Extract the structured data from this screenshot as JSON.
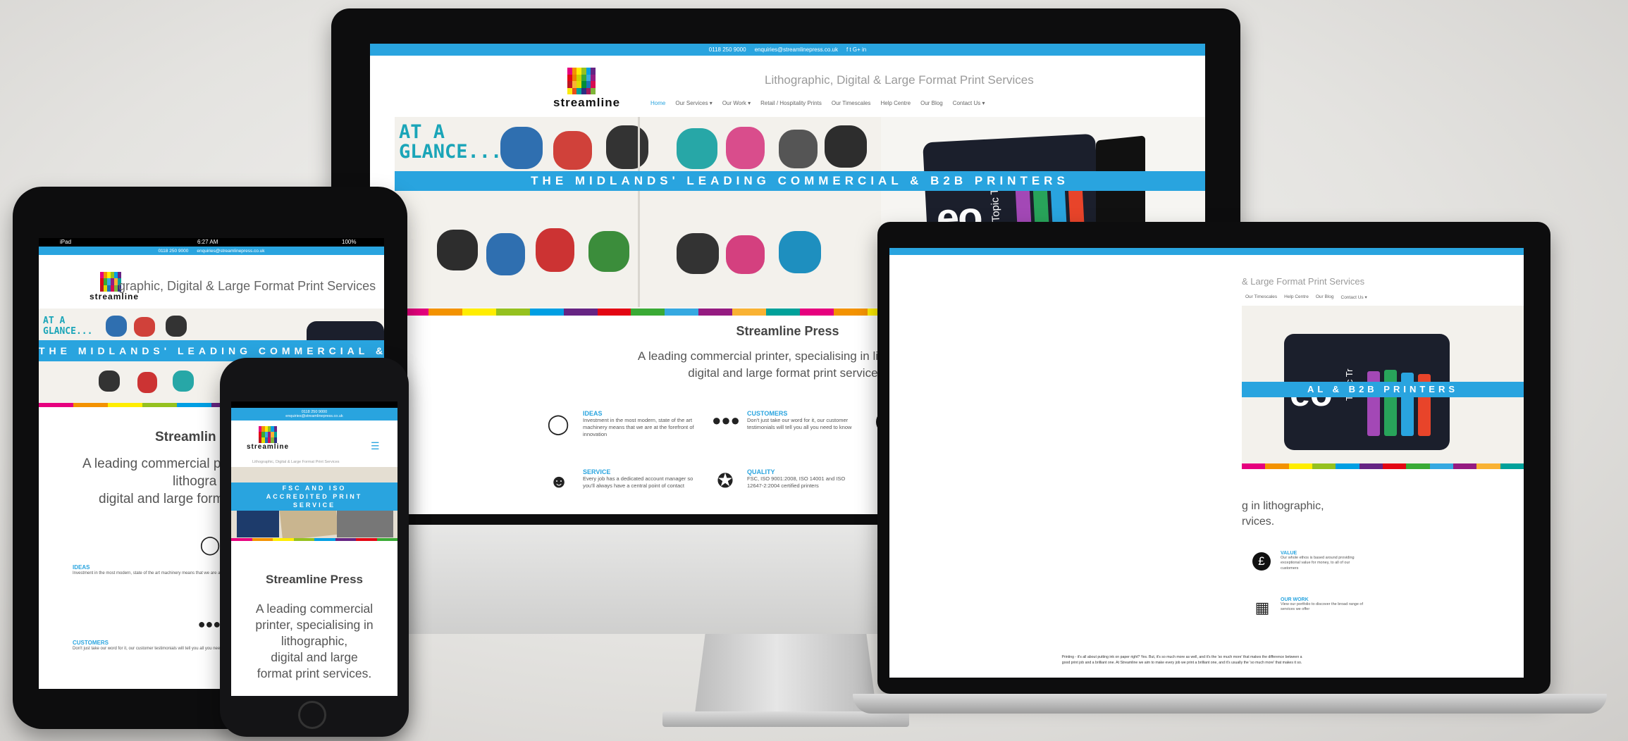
{
  "contact": {
    "phone": "0118 250 9000",
    "email": "enquiries@streamlinepress.co.uk",
    "social": "f  t  G+  in"
  },
  "brand": {
    "logo_text": "streamline",
    "tagline": "Lithographic, Digital & Large Format Print Services",
    "tagline_cut_tablet": "graphic, Digital & Large Format Print Services",
    "tagline_cut_laptop": "& Large Format Print Services"
  },
  "nav": [
    {
      "label": "Home"
    },
    {
      "label": "Our Services ▾"
    },
    {
      "label": "Our Work ▾"
    },
    {
      "label": "Retail / Hospitality Prints"
    },
    {
      "label": "Our Timescales"
    },
    {
      "label": "Help Centre"
    },
    {
      "label": "Our Blog"
    },
    {
      "label": "Contact Us ▾"
    }
  ],
  "hero": {
    "band": "THE MIDLANDS' LEADING COMMERCIAL & B2B PRINTERS",
    "band_tablet": "THE MIDLANDS' LEADING COMMERCIAL & B2B PRIN",
    "band_laptop": "AL & B2B PRINTERS",
    "band_phone": "FSC AND ISO ACCREDITED PRINT SERVICE",
    "mag_text": "AT A GLANCE...",
    "book_text": "Topic T",
    "book_text_laptop": "Topic Tr"
  },
  "content": {
    "title": "Streamline Press",
    "title_tablet": "Streamlin",
    "lead_1": "A leading commercial printer, specialising in lithographic,",
    "lead_2": "digital and large format print services.",
    "lead_tablet_1": "A leading commercial pr",
    "lead_tablet_2": "lithogra",
    "lead_tablet_3": "digital and large form",
    "lead_laptop_1": "g in lithographic,",
    "lead_laptop_2": "rvices.",
    "phone_lead": [
      "A leading commercial",
      "printer, specialising in",
      "lithographic,",
      "digital and large",
      "format print services."
    ],
    "footer_1": "Printing - it's all about putting ink on paper right? Yes. But, it's so much more as well, and it's the 'so much more' that makes the difference between a",
    "footer_2": "good print job and a brilliant one. At Streamline we aim to make every job we print a brilliant one, and it's usually the 'so much more' that makes it so."
  },
  "features": [
    {
      "icon": "lightbulb-icon",
      "title": "IDEAS",
      "text": "Investment in the most modern, state of the art machinery means that we are at the forefront of innovation"
    },
    {
      "icon": "people-icon",
      "title": "CUSTOMERS",
      "text": "Don't just take our word for it, our customer testimonials will tell you all you need to know"
    },
    {
      "icon": "pound-icon",
      "title": "VALUE",
      "text": "Our whole ethos is based around providing exceptional value for money, to all of our customers"
    },
    {
      "icon": "smiley-icon",
      "title": "SERVICE",
      "text": "Every job has a dedicated account manager so you'll always have a central point of contact"
    },
    {
      "icon": "award-icon",
      "title": "QUALITY",
      "text": "FSC, ISO 9001:2008, ISO 14001 and ISO 12647-2:2004 certified printers"
    },
    {
      "icon": "easel-icon",
      "title": "OUR WORK",
      "text": "View our portfolio to discover the broad range of services we offer"
    }
  ],
  "tablet_features": [
    {
      "title": "IDEAS",
      "text": "Investment in the most modern, state of the art machinery means that we are at the forefront of innovation"
    },
    {
      "title": "CUSTOMERS",
      "text": "Don't just take our word for it, our customer testimonials will tell you all you need to know"
    }
  ],
  "ipad_status": {
    "left": "iPad",
    "time": "6:27 AM",
    "battery": "100%"
  },
  "colors": {
    "accent": "#29a4df",
    "bezel": "#0d0d0e"
  }
}
